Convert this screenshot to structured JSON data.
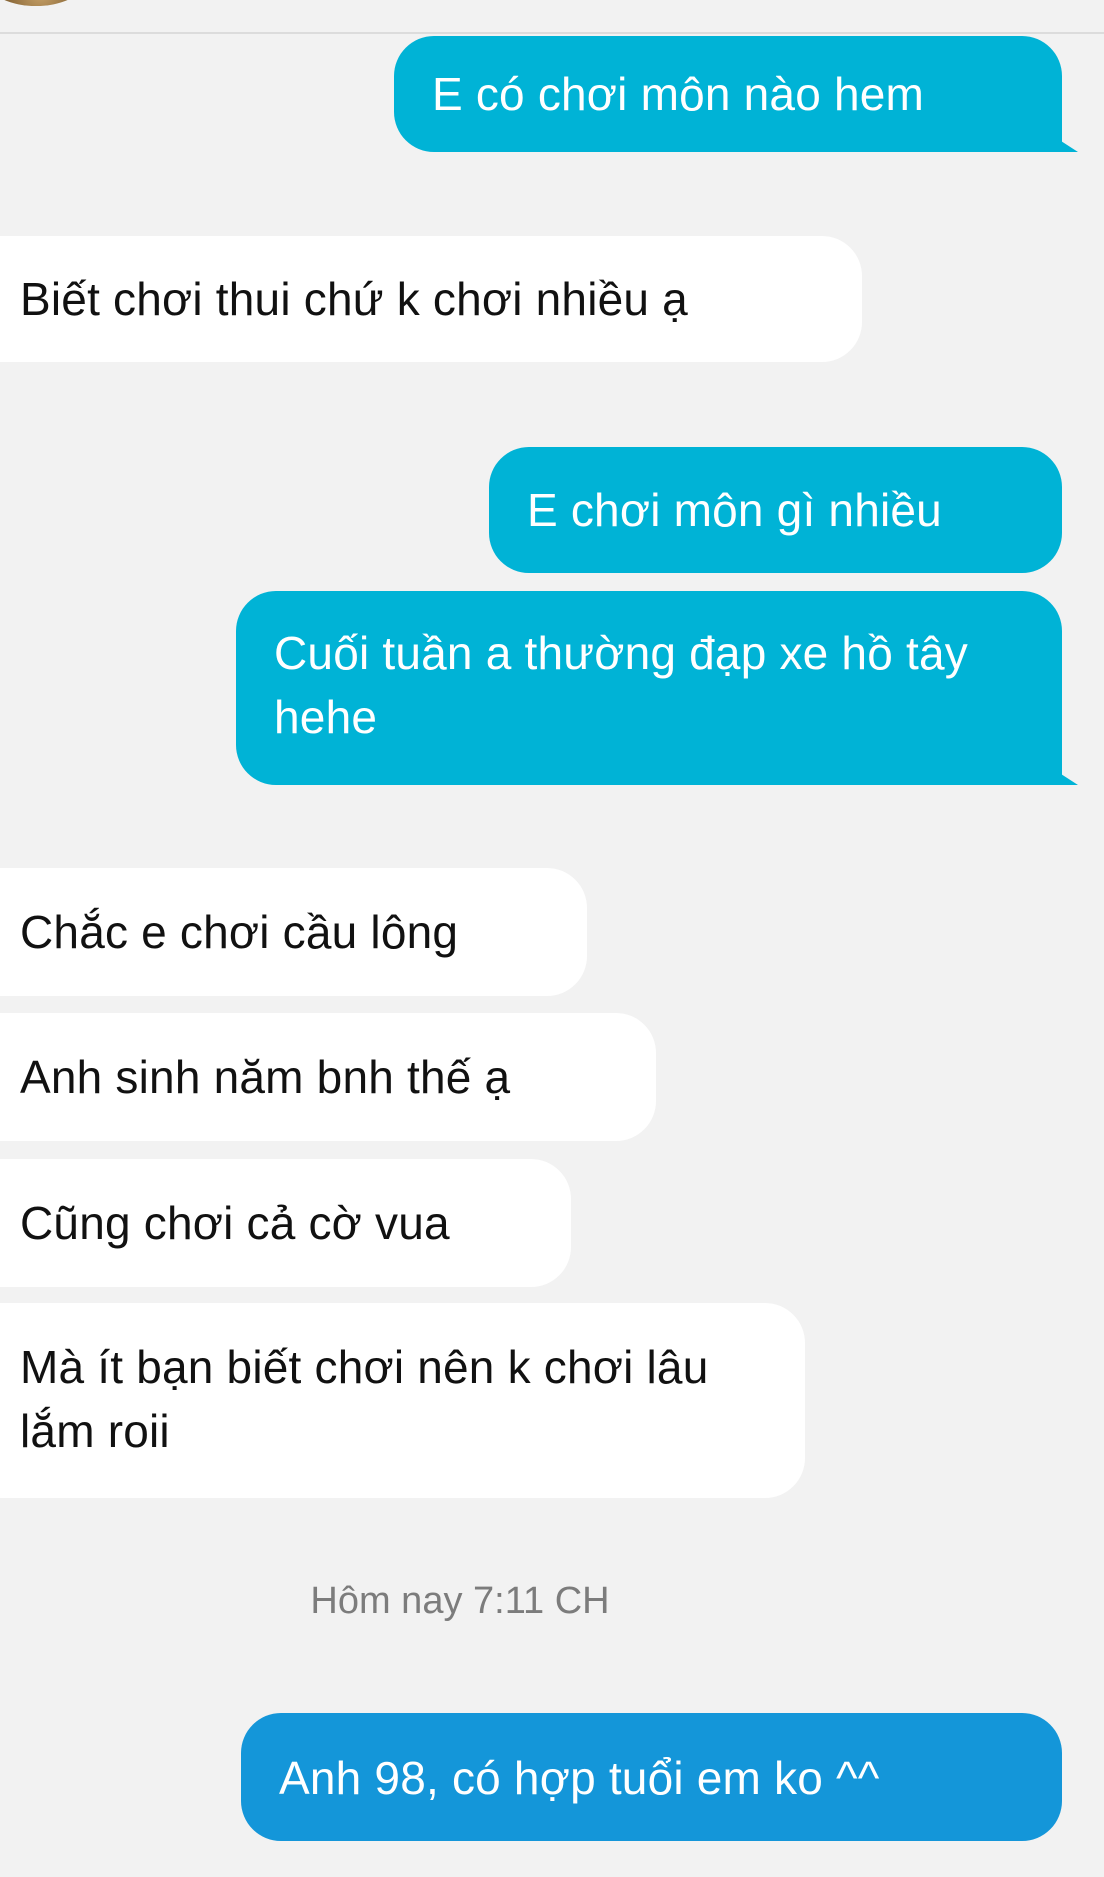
{
  "colors": {
    "background": "#f2f2f2",
    "outgoing_bubble": "#00b3d6",
    "outgoing_last_bubble": "#1496d9",
    "incoming_bubble": "#ffffff",
    "timestamp_text": "#7c7c7c"
  },
  "icons": {
    "avatar": "contact-avatar-icon"
  },
  "messages": [
    {
      "direction": "out",
      "text": "E có chơi môn nào hem"
    },
    {
      "direction": "in",
      "text": "Biết chơi thui chứ k chơi nhiều ạ"
    },
    {
      "direction": "out",
      "text": "E chơi môn gì nhiều"
    },
    {
      "direction": "out",
      "text": "Cuối tuần a thường đạp xe hồ tây hehe"
    },
    {
      "direction": "in",
      "text": "Chắc e chơi cầu lông"
    },
    {
      "direction": "in",
      "text": "Anh sinh năm bnh thế ạ"
    },
    {
      "direction": "in",
      "text": "Cũng chơi cả cờ vua"
    },
    {
      "direction": "in",
      "text": "Mà ít bạn biết chơi nên k chơi lâu lắm roii"
    },
    {
      "direction": "out",
      "text": "Anh 98, có hợp tuổi em ko ^^"
    }
  ],
  "timestamp": "Hôm nay 7:11 CH"
}
